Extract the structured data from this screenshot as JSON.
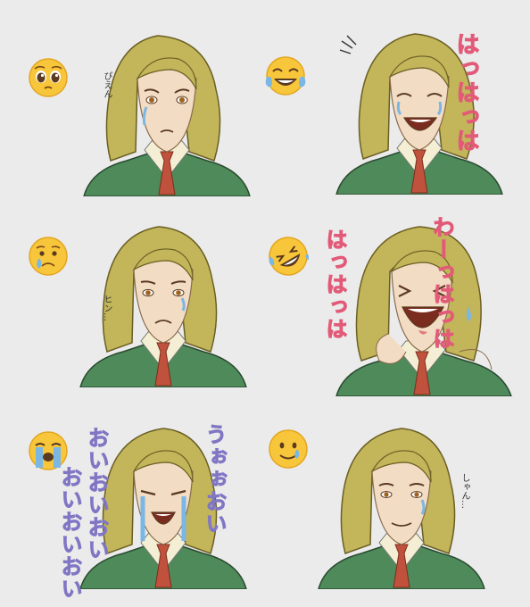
{
  "panels": [
    {
      "emoji": "pleading-face",
      "sfx": "ぴえん",
      "sfx_style": "note"
    },
    {
      "emoji": "face-with-tears-of-joy",
      "sfx": "はっはっは",
      "sfx_style": "pink"
    },
    {
      "emoji": "sad-crying-face",
      "sfx": "ヒン…",
      "sfx_style": "note"
    },
    {
      "emoji": "rolling-on-floor-laughing",
      "sfx": [
        "わーっはっは",
        "はっはっは"
      ],
      "sfx_style": "pink"
    },
    {
      "emoji": "loudly-crying-face",
      "sfx": [
        "うぉぉおい",
        "おいおいおい",
        "おいおいおい"
      ],
      "sfx_style": "lilac"
    },
    {
      "emoji": "smiling-face-with-tear",
      "sfx": "しゃん…",
      "sfx_style": "note"
    }
  ],
  "colors": {
    "background": "#ebebeb",
    "hair": "#c2b55a",
    "skin": "#f2dcc4",
    "jacket": "#4e8a5a",
    "shirt": "#f4efd4",
    "tie": "#c0523d",
    "tear": "#7ab7e4",
    "emoji_yellow": "#f8c63a",
    "sfx_pink": "#e25a78",
    "sfx_lilac": "#8076c4"
  }
}
